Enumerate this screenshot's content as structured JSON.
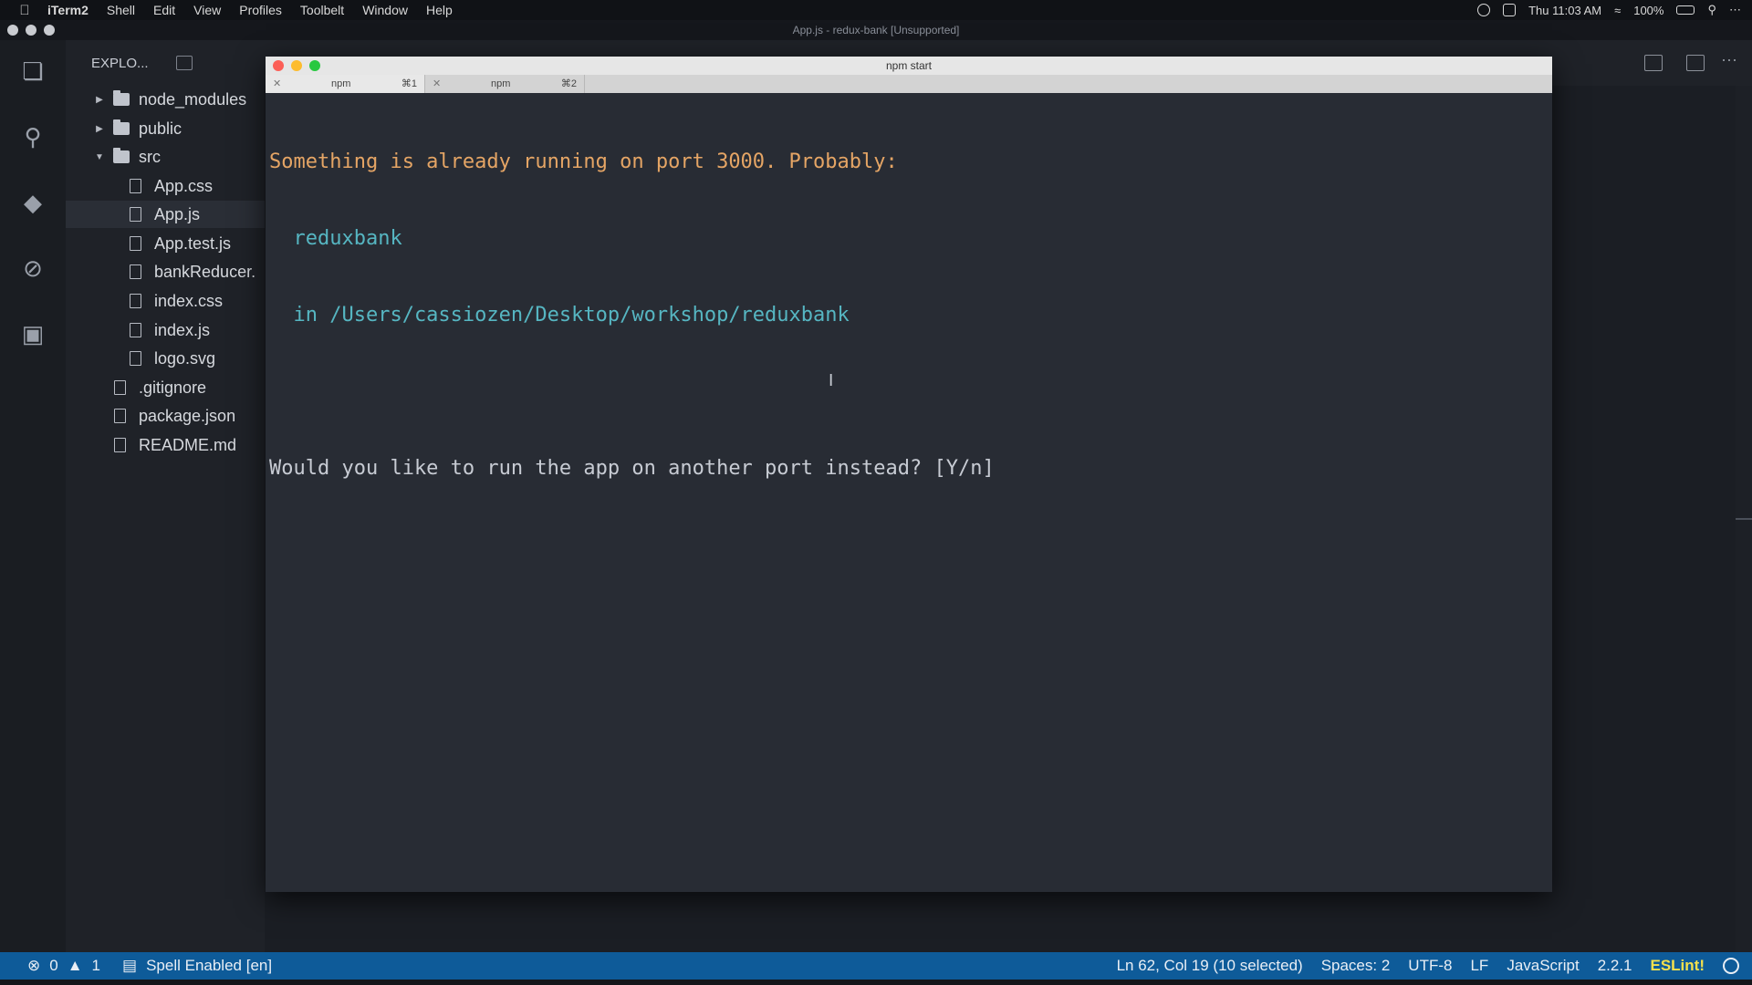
{
  "menubar": {
    "app_name": "iTerm2",
    "items": [
      "Shell",
      "Edit",
      "View",
      "Profiles",
      "Toolbelt",
      "Window",
      "Help"
    ],
    "clock": "Thu 11:03 AM",
    "battery": "100%"
  },
  "vscode": {
    "window_title": "App.js - redux-bank [Unsupported]",
    "explorer_title": "EXPLO...",
    "tree": [
      {
        "label": "node_modules",
        "type": "folder",
        "expanded": false,
        "depth": 0
      },
      {
        "label": "public",
        "type": "folder",
        "expanded": false,
        "depth": 0
      },
      {
        "label": "src",
        "type": "folder",
        "expanded": true,
        "depth": 0
      },
      {
        "label": "App.css",
        "type": "file",
        "depth": 1
      },
      {
        "label": "App.js",
        "type": "file",
        "depth": 1,
        "selected": true
      },
      {
        "label": "App.test.js",
        "type": "file",
        "depth": 1
      },
      {
        "label": "bankReducer.",
        "type": "file",
        "depth": 1
      },
      {
        "label": "index.css",
        "type": "file",
        "depth": 1
      },
      {
        "label": "index.js",
        "type": "file",
        "depth": 1
      },
      {
        "label": "logo.svg",
        "type": "file",
        "depth": 1
      },
      {
        "label": ".gitignore",
        "type": "file",
        "depth": 0
      },
      {
        "label": "package.json",
        "type": "file",
        "depth": 0
      },
      {
        "label": "README.md",
        "type": "file",
        "depth": 0
      }
    ]
  },
  "iterm": {
    "title": "npm start",
    "tabs": [
      {
        "name": "npm",
        "shortcut": "⌘1"
      },
      {
        "name": "npm",
        "shortcut": "⌘2"
      }
    ],
    "lines": {
      "line1": "Something is already running on port 3000. Probably:",
      "line2": "  reduxbank",
      "line3": "  in /Users/cassiozen/Desktop/workshop/reduxbank",
      "line4": "Would you like to run the app on another port instead? [Y/n]"
    }
  },
  "statusbar": {
    "errors": "0",
    "warnings": "1",
    "spell": "Spell Enabled [en]",
    "position": "Ln 62, Col 19 (10 selected)",
    "spaces": "Spaces: 2",
    "encoding": "UTF-8",
    "eol": "LF",
    "language": "JavaScript",
    "version": "2.2.1",
    "linter": "ESLint!"
  },
  "colors": {
    "terminal_orange": "#e5a565",
    "terminal_cyan": "#56b6c2",
    "statusbar_blue": "#0e5b99",
    "eslint_yellow": "#f4e04d"
  }
}
